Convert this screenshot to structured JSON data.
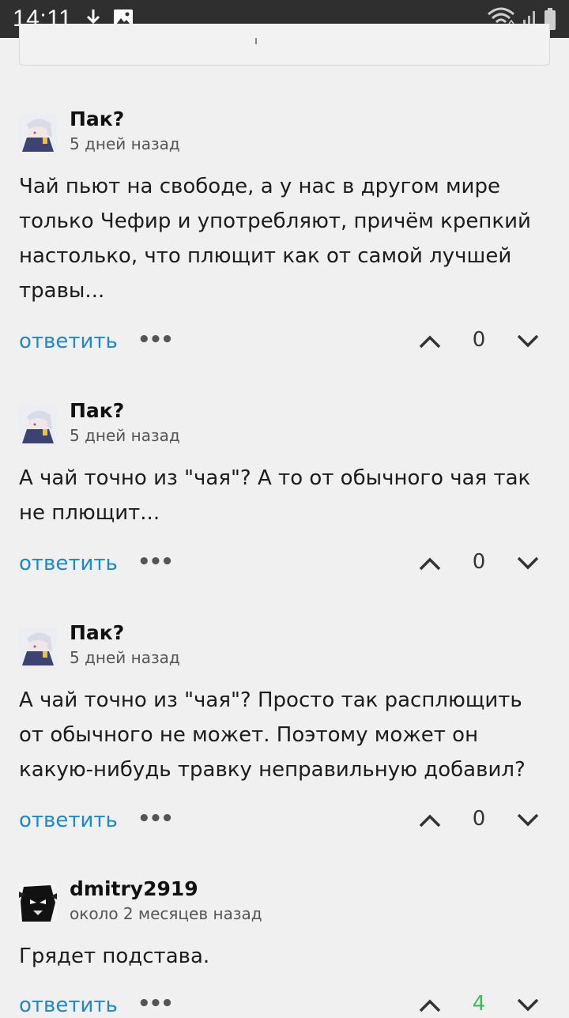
{
  "status_bar": {
    "time": "14:11",
    "icons": [
      "download-icon",
      "image-icon",
      "wifi-icon",
      "signal-icon",
      "battery-icon"
    ]
  },
  "comments": [
    {
      "author": "Пак?",
      "time": "5 дней назад",
      "text": "Чай пьют на свободе, а у нас в другом мире только Чефир и употребляют, причём крепкий настолько, что плющит как от самой лучшей травы...",
      "reply_label": "ответить",
      "more_label": "•••",
      "score": "0"
    },
    {
      "author": "Пак?",
      "time": "5 дней назад",
      "text": "А чай точно из \"чая\"? А то от обычного чая так не плющит...",
      "reply_label": "ответить",
      "more_label": "•••",
      "score": "0"
    },
    {
      "author": "Пак?",
      "time": "5 дней назад",
      "text": "А чай точно из \"чая\"? Просто так расплющить от обычного не может. Поэтому может он какую-нибудь травку неправильную добавил?",
      "reply_label": "ответить",
      "more_label": "•••",
      "score": "0"
    },
    {
      "author": "dmitry2919",
      "time": "около 2 месяцев назад",
      "text": "Грядет подстава.",
      "reply_label": "ответить",
      "more_label": "•••",
      "score": "4"
    }
  ],
  "colors": {
    "link": "#1e88c8",
    "positive_score": "#3db85c",
    "status_bar": "#2f2f2f",
    "background": "#f0f0f0"
  }
}
